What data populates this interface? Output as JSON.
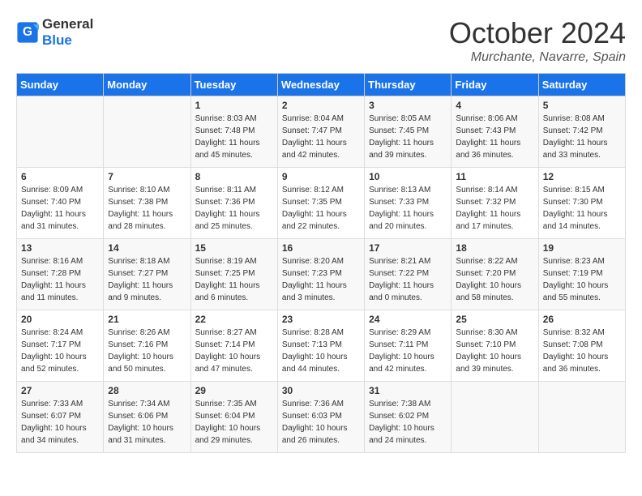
{
  "header": {
    "logo_general": "General",
    "logo_blue": "Blue",
    "month_title": "October 2024",
    "location": "Murchante, Navarre, Spain"
  },
  "weekdays": [
    "Sunday",
    "Monday",
    "Tuesday",
    "Wednesday",
    "Thursday",
    "Friday",
    "Saturday"
  ],
  "weeks": [
    [
      null,
      null,
      {
        "day": "1",
        "sunrise": "8:03 AM",
        "sunset": "7:48 PM",
        "daylight": "11 hours and 45 minutes."
      },
      {
        "day": "2",
        "sunrise": "8:04 AM",
        "sunset": "7:47 PM",
        "daylight": "11 hours and 42 minutes."
      },
      {
        "day": "3",
        "sunrise": "8:05 AM",
        "sunset": "7:45 PM",
        "daylight": "11 hours and 39 minutes."
      },
      {
        "day": "4",
        "sunrise": "8:06 AM",
        "sunset": "7:43 PM",
        "daylight": "11 hours and 36 minutes."
      },
      {
        "day": "5",
        "sunrise": "8:08 AM",
        "sunset": "7:42 PM",
        "daylight": "11 hours and 33 minutes."
      }
    ],
    [
      {
        "day": "6",
        "sunrise": "8:09 AM",
        "sunset": "7:40 PM",
        "daylight": "11 hours and 31 minutes."
      },
      {
        "day": "7",
        "sunrise": "8:10 AM",
        "sunset": "7:38 PM",
        "daylight": "11 hours and 28 minutes."
      },
      {
        "day": "8",
        "sunrise": "8:11 AM",
        "sunset": "7:36 PM",
        "daylight": "11 hours and 25 minutes."
      },
      {
        "day": "9",
        "sunrise": "8:12 AM",
        "sunset": "7:35 PM",
        "daylight": "11 hours and 22 minutes."
      },
      {
        "day": "10",
        "sunrise": "8:13 AM",
        "sunset": "7:33 PM",
        "daylight": "11 hours and 20 minutes."
      },
      {
        "day": "11",
        "sunrise": "8:14 AM",
        "sunset": "7:32 PM",
        "daylight": "11 hours and 17 minutes."
      },
      {
        "day": "12",
        "sunrise": "8:15 AM",
        "sunset": "7:30 PM",
        "daylight": "11 hours and 14 minutes."
      }
    ],
    [
      {
        "day": "13",
        "sunrise": "8:16 AM",
        "sunset": "7:28 PM",
        "daylight": "11 hours and 11 minutes."
      },
      {
        "day": "14",
        "sunrise": "8:18 AM",
        "sunset": "7:27 PM",
        "daylight": "11 hours and 9 minutes."
      },
      {
        "day": "15",
        "sunrise": "8:19 AM",
        "sunset": "7:25 PM",
        "daylight": "11 hours and 6 minutes."
      },
      {
        "day": "16",
        "sunrise": "8:20 AM",
        "sunset": "7:23 PM",
        "daylight": "11 hours and 3 minutes."
      },
      {
        "day": "17",
        "sunrise": "8:21 AM",
        "sunset": "7:22 PM",
        "daylight": "11 hours and 0 minutes."
      },
      {
        "day": "18",
        "sunrise": "8:22 AM",
        "sunset": "7:20 PM",
        "daylight": "10 hours and 58 minutes."
      },
      {
        "day": "19",
        "sunrise": "8:23 AM",
        "sunset": "7:19 PM",
        "daylight": "10 hours and 55 minutes."
      }
    ],
    [
      {
        "day": "20",
        "sunrise": "8:24 AM",
        "sunset": "7:17 PM",
        "daylight": "10 hours and 52 minutes."
      },
      {
        "day": "21",
        "sunrise": "8:26 AM",
        "sunset": "7:16 PM",
        "daylight": "10 hours and 50 minutes."
      },
      {
        "day": "22",
        "sunrise": "8:27 AM",
        "sunset": "7:14 PM",
        "daylight": "10 hours and 47 minutes."
      },
      {
        "day": "23",
        "sunrise": "8:28 AM",
        "sunset": "7:13 PM",
        "daylight": "10 hours and 44 minutes."
      },
      {
        "day": "24",
        "sunrise": "8:29 AM",
        "sunset": "7:11 PM",
        "daylight": "10 hours and 42 minutes."
      },
      {
        "day": "25",
        "sunrise": "8:30 AM",
        "sunset": "7:10 PM",
        "daylight": "10 hours and 39 minutes."
      },
      {
        "day": "26",
        "sunrise": "8:32 AM",
        "sunset": "7:08 PM",
        "daylight": "10 hours and 36 minutes."
      }
    ],
    [
      {
        "day": "27",
        "sunrise": "7:33 AM",
        "sunset": "6:07 PM",
        "daylight": "10 hours and 34 minutes."
      },
      {
        "day": "28",
        "sunrise": "7:34 AM",
        "sunset": "6:06 PM",
        "daylight": "10 hours and 31 minutes."
      },
      {
        "day": "29",
        "sunrise": "7:35 AM",
        "sunset": "6:04 PM",
        "daylight": "10 hours and 29 minutes."
      },
      {
        "day": "30",
        "sunrise": "7:36 AM",
        "sunset": "6:03 PM",
        "daylight": "10 hours and 26 minutes."
      },
      {
        "day": "31",
        "sunrise": "7:38 AM",
        "sunset": "6:02 PM",
        "daylight": "10 hours and 24 minutes."
      },
      null,
      null
    ]
  ]
}
